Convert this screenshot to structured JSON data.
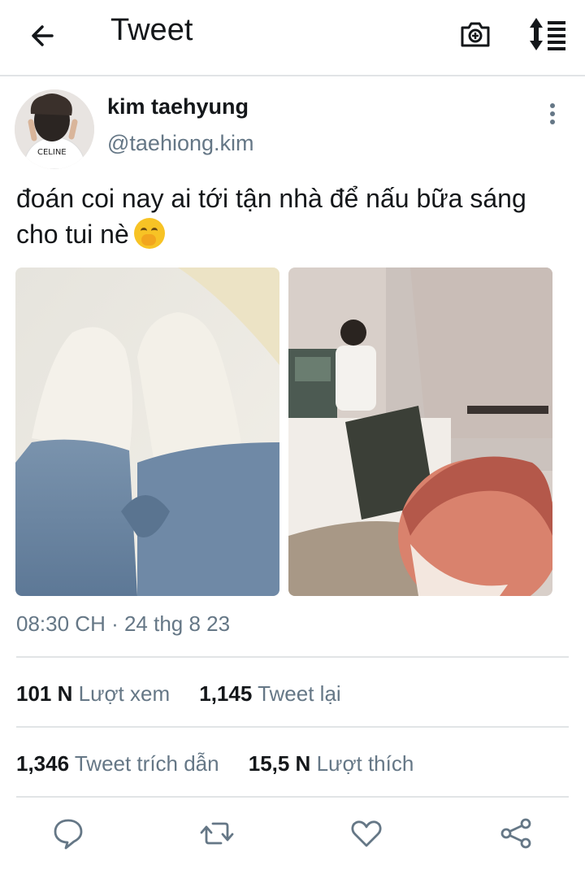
{
  "header": {
    "title": "Tweet"
  },
  "tweet": {
    "author_name": "kim taehyung",
    "author_handle": "@taehiong.kim",
    "text": "đoán coi nay ai tới tận nhà để nấu bữa sáng cho tui nè",
    "emoji": "face-with-hand-over-mouth",
    "timestamp": "08:30 CH · 24 thg 8 23",
    "avatar_shirt_text": "CELINE"
  },
  "stats": {
    "views_count": "101 N",
    "views_label": "Lượt xem",
    "retweets_count": "1,145",
    "retweets_label": "Tweet lại",
    "quotes_count": "1,346",
    "quotes_label": "Tweet trích dẫn",
    "likes_count": "15,5 N",
    "likes_label": "Lượt thích"
  },
  "icons": [
    "back-arrow-icon",
    "camera-icon",
    "sort-icon",
    "more-vertical-icon",
    "reply-icon",
    "retweet-icon",
    "like-icon",
    "share-icon"
  ],
  "colors": {
    "text": "#14171a",
    "secondary": "#657786",
    "divider": "#e1e4e6"
  }
}
